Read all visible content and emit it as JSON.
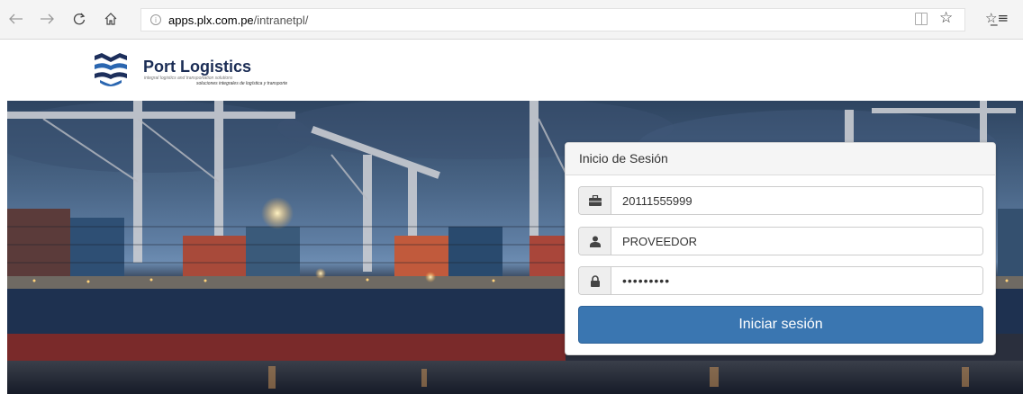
{
  "browser": {
    "url_host": "apps.plx.com.pe",
    "url_path": "/intranetpl/",
    "icons": [
      "back-icon",
      "forward-icon",
      "refresh-icon",
      "home-icon",
      "info-icon",
      "reading-view-icon",
      "star-icon",
      "favorites-icon"
    ]
  },
  "site": {
    "brand_name": "Port Logistics",
    "tagline_en": "integral logistics and transportation solutions",
    "tagline_es": "soluciones integrales de logística y transporte",
    "brand_color": "#1b2d55"
  },
  "login": {
    "title": "Inicio de Sesión",
    "ruc_value": "20111555999",
    "user_value": "PROVEEDOR",
    "password_mask": "•••••••••",
    "submit_label": "Iniciar sesión",
    "button_color": "#3a76b1",
    "icons": [
      "briefcase-icon",
      "user-icon",
      "lock-icon"
    ]
  }
}
